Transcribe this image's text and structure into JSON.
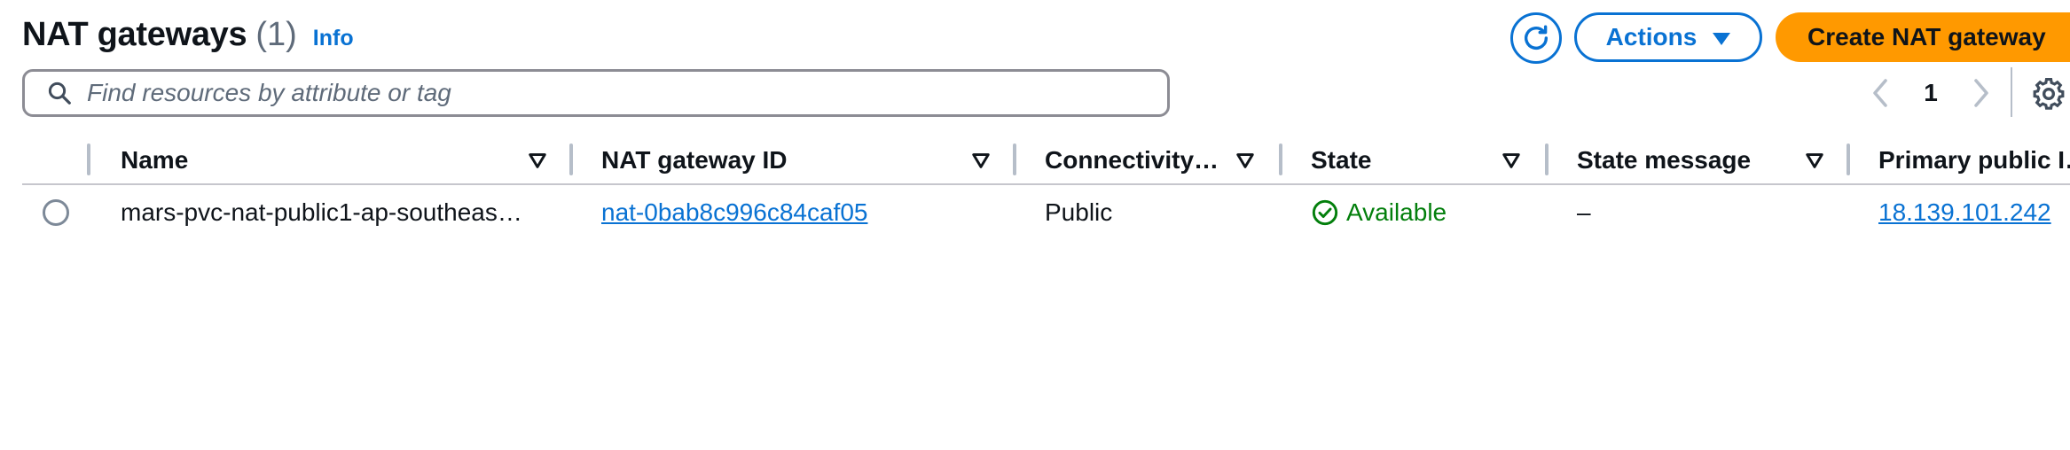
{
  "header": {
    "title": "NAT gateways",
    "count": "(1)",
    "info": "Info",
    "actions_label": "Actions",
    "create_label": "Create NAT gateway"
  },
  "search": {
    "placeholder": "Find resources by attribute or tag"
  },
  "pagination": {
    "current_page": "1"
  },
  "table": {
    "columns": [
      "Name",
      "NAT gateway ID",
      "Connectivity…",
      "State",
      "State message",
      "Primary public I…"
    ],
    "rows": [
      {
        "name": "mars-pvc-nat-public1-ap-southeas…",
        "nat_gateway_id": "nat-0bab8c996c84caf05",
        "connectivity": "Public",
        "state": "Available",
        "state_message": "–",
        "primary_public_ip": "18.139.101.242"
      }
    ]
  },
  "colors": {
    "accent": "#0972d3",
    "primary_button": "#ff9900",
    "success": "#037f0c"
  },
  "icons": [
    "refresh-icon",
    "caret-down-icon",
    "search-icon",
    "chevron-left-icon",
    "chevron-right-icon",
    "settings-icon",
    "sort-icon",
    "status-check-icon"
  ]
}
